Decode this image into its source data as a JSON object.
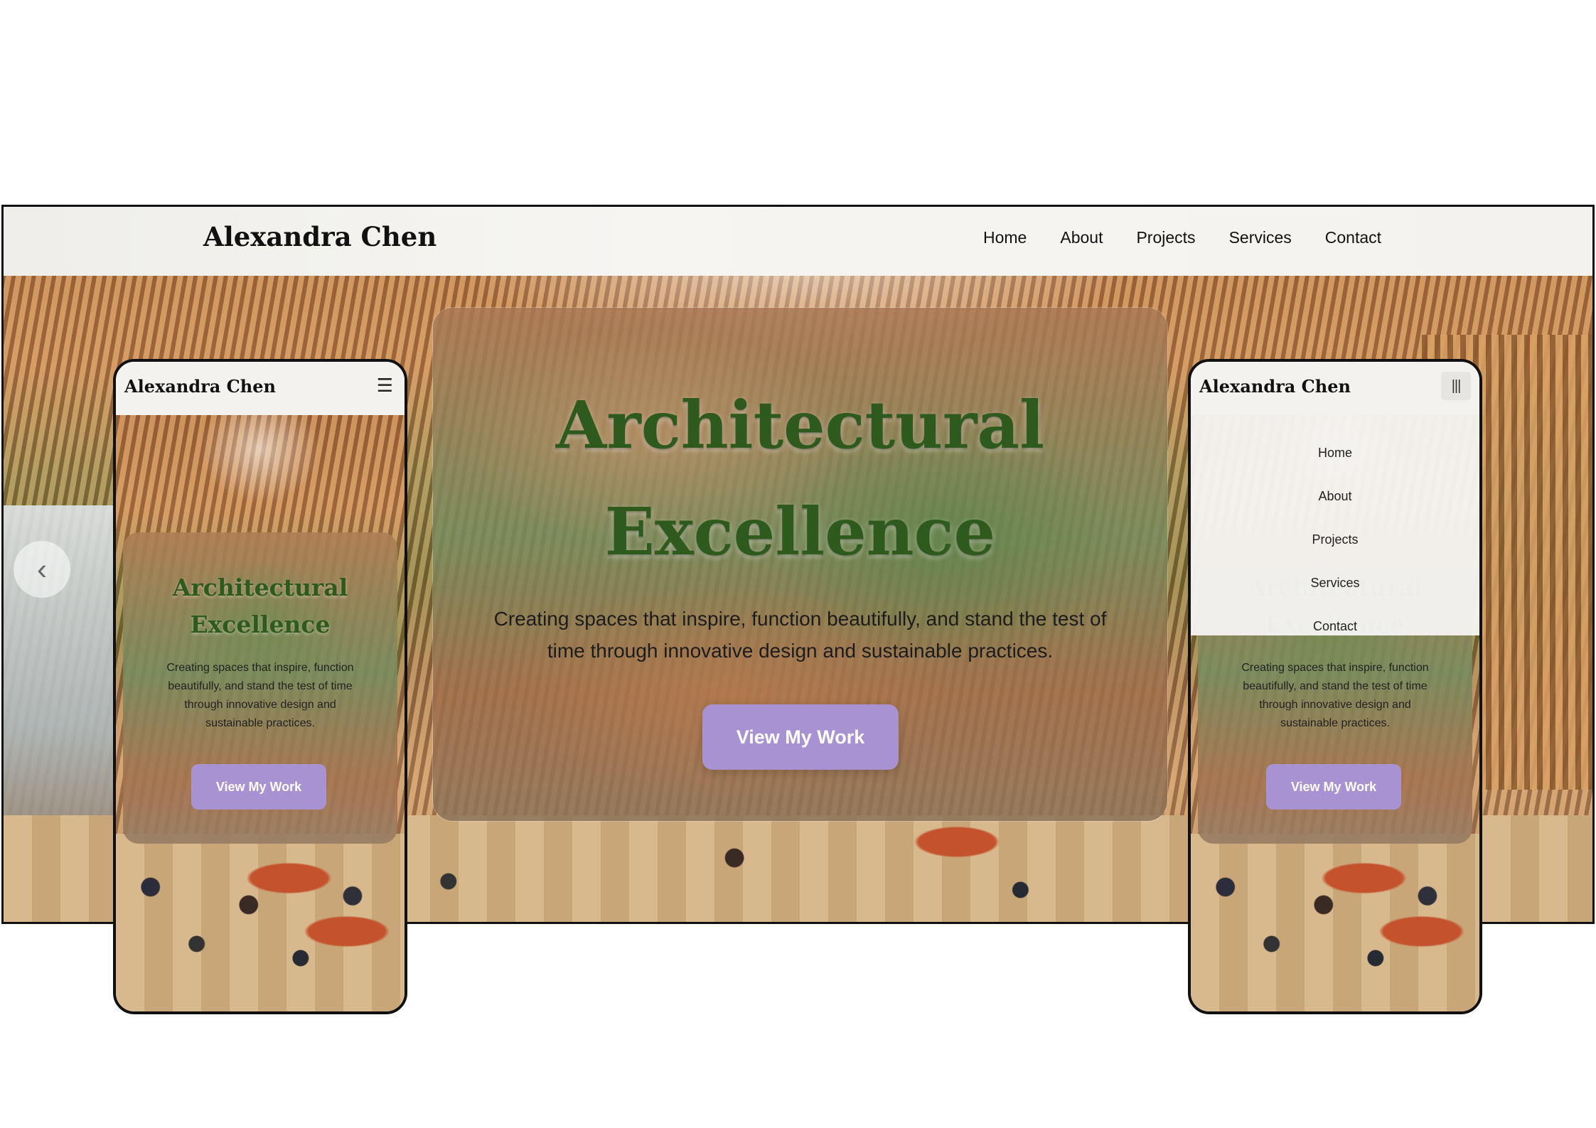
{
  "site": {
    "brand": "Alexandra Chen",
    "nav": [
      "Home",
      "About",
      "Projects",
      "Services",
      "Contact"
    ]
  },
  "hero": {
    "title": "Architectural Excellence",
    "subtitle": "Creating spaces that inspire, function beautifully, and stand the test of time through innovative design and sustainable practices.",
    "cta": "View My Work"
  },
  "icons": {
    "carousel_prev": "chevron-left-icon",
    "mobile_menu": "hamburger-icon",
    "mobile_menu_open": "menu-toggle-icon"
  },
  "colors": {
    "title_green": "#2f5a1e",
    "cta_purple": "#a992d2",
    "nav_bg": "#f4f2ee"
  }
}
